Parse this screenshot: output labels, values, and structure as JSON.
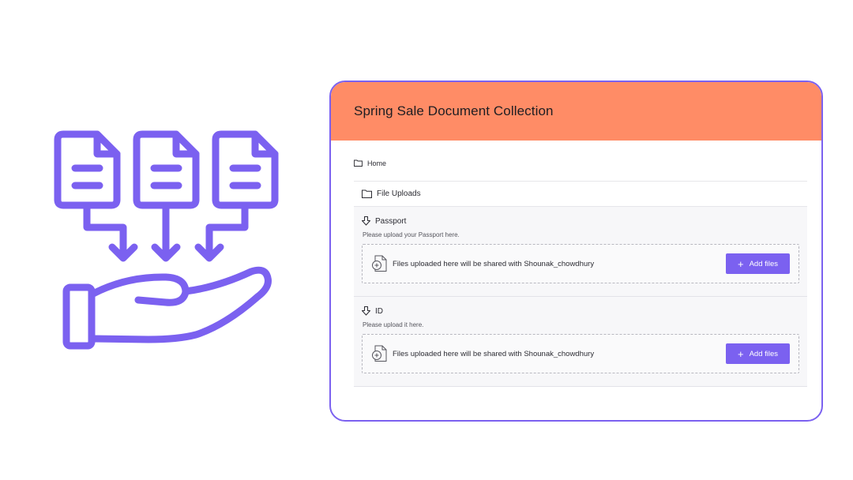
{
  "card": {
    "title": "Spring Sale Document Collection",
    "accent": "#7b61f0",
    "header_color": "#ff8c66"
  },
  "breadcrumb": {
    "label": "Home",
    "icon": "folder-icon"
  },
  "folder": {
    "label": "File Uploads",
    "icon": "folder-icon"
  },
  "sections": [
    {
      "title": "Passport",
      "description": "Please upload your Passport here.",
      "dropzone_text": "Files uploaded here will be shared with Shounak_chowdhury",
      "button_label": "Add files",
      "button_icon": "plus-icon"
    },
    {
      "title": "ID",
      "description": "Please upload it here.",
      "dropzone_text": "Files uploaded here will be shared with Shounak_chowdhury",
      "button_label": "Add files",
      "button_icon": "plus-icon"
    }
  ],
  "illustration": {
    "icon": "documents-to-hand-icon",
    "color": "#7b61f0"
  }
}
